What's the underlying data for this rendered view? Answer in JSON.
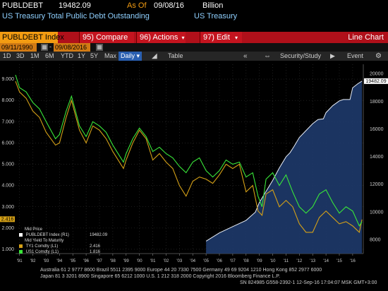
{
  "header": {
    "ticker": "PUBLDEBT",
    "last_value": "19482.09",
    "as_of_label": "As Of",
    "as_of_date": "09/08/16",
    "unit": "Billion",
    "description": "US Treasury Total Public Debt Outstanding",
    "source": "US Treasury"
  },
  "menu": {
    "index_label": "PUBLDEBT Index",
    "compare_label": "95) Compare",
    "actions_label": "96) Actions",
    "edit_label": "97) Edit",
    "chart_type": "Line Chart"
  },
  "dates": {
    "start": "09/11/1990",
    "end": "09/08/2016"
  },
  "toolbar": {
    "ranges": [
      "1D",
      "3D",
      "1M",
      "6M",
      "YTD",
      "1Y",
      "5Y",
      "Max"
    ],
    "period": "Daily",
    "table_label": "Table",
    "security_study_label": "Security/Study",
    "event_label": "Event",
    "back_icon": "double-chevron-left",
    "chart_icon": "mountain-chart",
    "settings_icon": "gear"
  },
  "legend": {
    "title": "Mid Price",
    "rows": [
      {
        "label": "PUBLDEBT Index (R1)",
        "value": "19482.09",
        "color": "#ffffff"
      },
      {
        "label": "Mid Yield To Maturity",
        "value": "",
        "color": ""
      },
      {
        "label": "TY1 Comdty (L1)",
        "value": "2.416",
        "color": "#d4a017"
      },
      {
        "label": "US1 Comdty (L1)",
        "value": "1.816",
        "color": "#39e639"
      }
    ]
  },
  "footer": {
    "line1": "Australia 61 2 9777 8600 Brazil 5511 2395 9000 Europe 44 20 7330 7500 Germany 49 69 9204 1210 Hong Kong 852 2977 6000",
    "line2": "Japan 81 3 3201 8900          Singapore 65 6212 1000          U.S. 1 212 318 2000          Copyright 2016 Bloomberg Finance L.P.",
    "line3": "SN 824985 G558-2392-1 12-Sep-16 17:04:07 MSK   GMT+3:00"
  },
  "chart_data": {
    "type": "line",
    "x_ticks": [
      "'91",
      "'92",
      "'93",
      "'94",
      "'95",
      "'96",
      "'97",
      "'98",
      "'99",
      "'00",
      "'01",
      "'02",
      "'03",
      "'04",
      "'05",
      "'06",
      "'07",
      "'08",
      "'09",
      "'10",
      "'11",
      "'12",
      "'13",
      "'14",
      "'15",
      "'16"
    ],
    "y_left_ticks": [
      "1.000",
      "2.000",
      "3.000",
      "4.000",
      "5.000",
      "6.000",
      "7.000",
      "8.000",
      "9.000"
    ],
    "y_left_range": [
      0.8,
      9.7
    ],
    "y_right_ticks": [
      "8000",
      "10000",
      "12000",
      "14000",
      "16000",
      "18000",
      "20000"
    ],
    "y_right_range": [
      7000,
      20700
    ],
    "last_price_labels": {
      "left_value": "2.416",
      "right_value": "19482.09"
    },
    "series": [
      {
        "name": "PUBLDEBT Index (R1)",
        "axis": "right",
        "style": "area",
        "color": "#1e3a6b",
        "x": [
          2005.0,
          2006.0,
          2007.0,
          2008.0,
          2008.7,
          2009.0,
          2009.5,
          2010.0,
          2010.5,
          2011.0,
          2011.3,
          2011.6,
          2012.0,
          2012.5,
          2013.0,
          2013.4,
          2013.8,
          2014.0,
          2014.5,
          2015.0,
          2015.3,
          2015.8,
          2016.0,
          2016.4,
          2016.7
        ],
        "y": [
          7900,
          8500,
          8950,
          9400,
          10000,
          10700,
          11500,
          12300,
          13200,
          14000,
          14300,
          14750,
          15400,
          15900,
          16400,
          16700,
          16750,
          17200,
          17700,
          18050,
          18150,
          18150,
          19000,
          19300,
          19482
        ]
      },
      {
        "name": "TY1 Comdty (L1)",
        "axis": "left",
        "style": "line",
        "color": "#d4a017",
        "x": [
          1990.7,
          1991.0,
          1991.5,
          1992.0,
          1992.5,
          1993.0,
          1993.7,
          1994.0,
          1994.5,
          1994.9,
          1995.5,
          1996.0,
          1996.5,
          1997.0,
          1997.5,
          1998.0,
          1998.8,
          1999.0,
          1999.5,
          2000.0,
          2000.5,
          2001.0,
          2001.5,
          2002.0,
          2002.5,
          2003.0,
          2003.5,
          2004.0,
          2004.5,
          2005.0,
          2005.5,
          2006.0,
          2006.5,
          2007.0,
          2007.5,
          2008.0,
          2008.5,
          2008.9,
          2009.2,
          2009.5,
          2010.0,
          2010.5,
          2011.0,
          2011.5,
          2012.0,
          2012.5,
          2013.0,
          2013.5,
          2014.0,
          2014.5,
          2015.0,
          2015.5,
          2016.0,
          2016.5,
          2016.7
        ],
        "y": [
          8.9,
          8.4,
          8.1,
          7.5,
          7.2,
          6.5,
          5.9,
          6.0,
          7.2,
          8.0,
          6.6,
          6.0,
          6.8,
          6.6,
          6.2,
          5.6,
          4.8,
          5.2,
          6.0,
          6.6,
          6.2,
          5.2,
          5.5,
          5.1,
          4.8,
          4.0,
          3.5,
          4.2,
          4.4,
          4.3,
          4.1,
          4.5,
          5.0,
          4.8,
          5.0,
          3.7,
          4.0,
          2.8,
          2.6,
          3.6,
          3.8,
          3.0,
          3.3,
          3.0,
          2.2,
          1.8,
          1.8,
          2.5,
          2.8,
          2.5,
          2.2,
          2.3,
          2.1,
          1.8,
          2.4
        ]
      },
      {
        "name": "US1 Comdty (L1)",
        "axis": "left",
        "style": "line",
        "color": "#39e639",
        "x": [
          1990.7,
          1991.0,
          1991.5,
          1992.0,
          1992.5,
          1993.0,
          1993.7,
          1994.0,
          1994.5,
          1994.9,
          1995.5,
          1996.0,
          1996.5,
          1997.0,
          1997.5,
          1998.0,
          1998.8,
          1999.0,
          1999.5,
          2000.0,
          2000.5,
          2001.0,
          2001.5,
          2002.0,
          2002.5,
          2003.0,
          2003.5,
          2004.0,
          2004.5,
          2005.0,
          2005.5,
          2006.0,
          2006.5,
          2007.0,
          2007.5,
          2008.0,
          2008.5,
          2008.9,
          2009.2,
          2009.5,
          2010.0,
          2010.5,
          2011.0,
          2011.5,
          2012.0,
          2012.5,
          2013.0,
          2013.5,
          2014.0,
          2014.5,
          2015.0,
          2015.5,
          2016.0,
          2016.5,
          2016.7
        ],
        "y": [
          9.2,
          8.6,
          8.4,
          7.9,
          7.6,
          7.0,
          6.2,
          6.4,
          7.5,
          8.2,
          6.8,
          6.3,
          7.0,
          6.8,
          6.5,
          5.9,
          5.1,
          5.5,
          6.2,
          6.7,
          6.3,
          5.6,
          5.8,
          5.5,
          5.3,
          4.9,
          4.6,
          5.1,
          5.3,
          4.7,
          4.4,
          4.7,
          5.2,
          5.0,
          5.1,
          4.4,
          4.6,
          3.5,
          3.0,
          4.3,
          4.6,
          4.0,
          4.5,
          3.7,
          3.0,
          2.7,
          3.0,
          3.6,
          3.8,
          3.2,
          2.7,
          3.0,
          2.8,
          2.1,
          2.3
        ]
      }
    ]
  }
}
